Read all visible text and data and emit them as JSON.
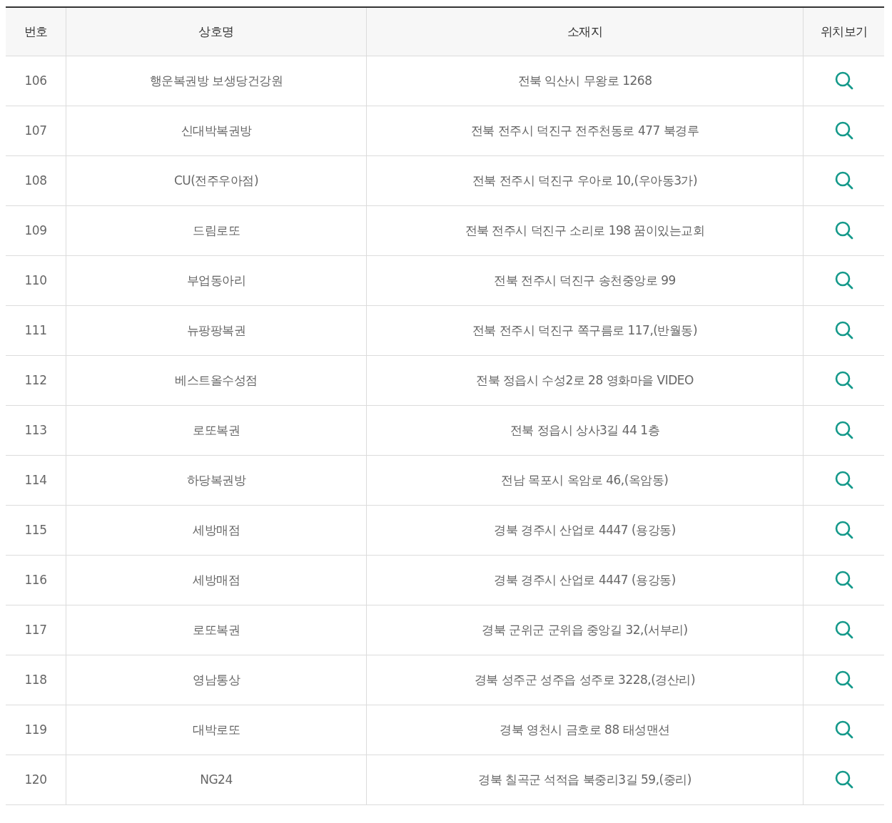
{
  "table": {
    "columns": [
      "번호",
      "상호명",
      "소재지",
      "위치보기"
    ],
    "rows": [
      {
        "number": "106",
        "name": "행운복권방 보생당건강원",
        "address": "전북 익산시 무왕로 1268"
      },
      {
        "number": "107",
        "name": "신대박복권방",
        "address": "전북 전주시 덕진구 전주천동로 477 북경루"
      },
      {
        "number": "108",
        "name": "CU(전주우아점)",
        "address": "전북 전주시 덕진구 우아로 10,(우아동3가)"
      },
      {
        "number": "109",
        "name": "드림로또",
        "address": "전북 전주시 덕진구 소리로 198 꿈이있는교회"
      },
      {
        "number": "110",
        "name": "부업동아리",
        "address": "전북 전주시 덕진구 송천중앙로 99"
      },
      {
        "number": "111",
        "name": "뉴팡팡복권",
        "address": "전북 전주시 덕진구 쪽구름로 117,(반월동)"
      },
      {
        "number": "112",
        "name": "베스트올수성점",
        "address": "전북 정읍시 수성2로 28 영화마을 VIDEO"
      },
      {
        "number": "113",
        "name": "로또복권",
        "address": "전북 정읍시 상사3길 44 1층"
      },
      {
        "number": "114",
        "name": "하당복권방",
        "address": "전남 목포시 옥암로 46,(옥암동)"
      },
      {
        "number": "115",
        "name": "세방매점",
        "address": "경북 경주시 산업로 4447 (용강동)"
      },
      {
        "number": "116",
        "name": "세방매점",
        "address": "경북 경주시 산업로 4447 (용강동)"
      },
      {
        "number": "117",
        "name": "로또복권",
        "address": "경북 군위군 군위읍 중앙길 32,(서부리)"
      },
      {
        "number": "118",
        "name": "영남통상",
        "address": "경북 성주군 성주읍 성주로 3228,(경산리)"
      },
      {
        "number": "119",
        "name": "대박로또",
        "address": "경북 영천시 금호로 88 태성맨션"
      },
      {
        "number": "120",
        "name": "NG24",
        "address": "경북 칠곡군 석적읍 북중리3길 59,(중리)"
      }
    ]
  }
}
